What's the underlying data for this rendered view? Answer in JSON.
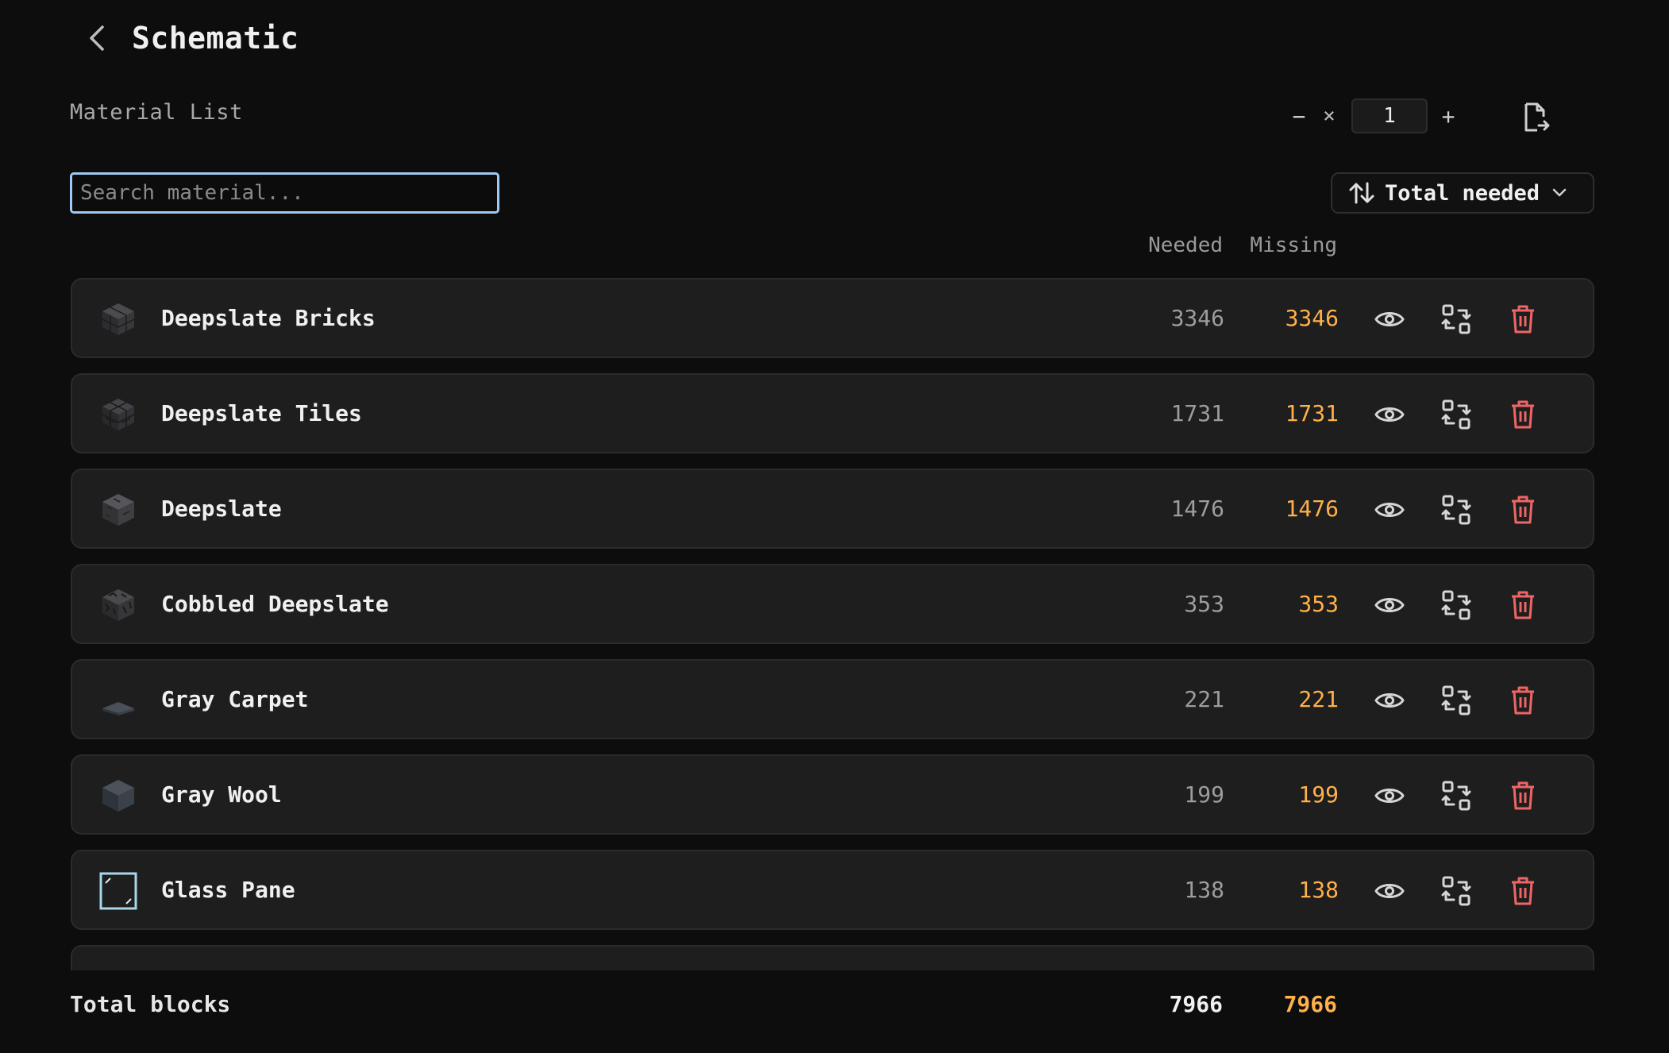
{
  "header": {
    "title": "Schematic",
    "back_icon": "chevron-left-icon"
  },
  "materials": {
    "subtitle": "Material List",
    "quantity": {
      "decrement_label": "−",
      "times_label": "×",
      "value": "1",
      "increment_label": "+"
    },
    "export_icon": "file-export-icon"
  },
  "search": {
    "placeholder": "Search material...",
    "value": ""
  },
  "sort": {
    "label": "Total needed",
    "icon": "sort-arrows-icon"
  },
  "columns": {
    "needed": "Needed",
    "missing": "Missing"
  },
  "colors": {
    "missing": "#ffb04a",
    "delete": "#ef6565",
    "search_border": "#9dc9f2",
    "row_bg": "#1e1e1e"
  },
  "rows": [
    {
      "name": "Deepslate Bricks",
      "needed": "3346",
      "missing": "3346",
      "icon": "deepslate-bricks-block"
    },
    {
      "name": "Deepslate Tiles",
      "needed": "1731",
      "missing": "1731",
      "icon": "deepslate-tiles-block"
    },
    {
      "name": "Deepslate",
      "needed": "1476",
      "missing": "1476",
      "icon": "deepslate-block"
    },
    {
      "name": "Cobbled Deepslate",
      "needed": "353",
      "missing": "353",
      "icon": "cobbled-deepslate-block"
    },
    {
      "name": "Gray Carpet",
      "needed": "221",
      "missing": "221",
      "icon": "gray-carpet-block"
    },
    {
      "name": "Gray Wool",
      "needed": "199",
      "missing": "199",
      "icon": "gray-wool-block"
    },
    {
      "name": "Glass Pane",
      "needed": "138",
      "missing": "138",
      "icon": "glass-pane-block"
    }
  ],
  "footer": {
    "label": "Total blocks",
    "needed": "7966",
    "missing": "7966"
  }
}
